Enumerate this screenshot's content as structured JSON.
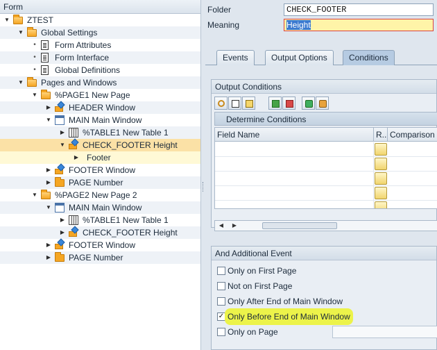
{
  "tree": {
    "header": "Form",
    "nodes": [
      {
        "label": "ZTEST",
        "depth": 0,
        "icon": "folder-open",
        "toggle": "expanded"
      },
      {
        "label": "Global Settings",
        "depth": 1,
        "icon": "folder-open",
        "toggle": "expanded"
      },
      {
        "label": "Form Attributes",
        "depth": 2,
        "icon": "document",
        "toggle": "leaf"
      },
      {
        "label": "Form Interface",
        "depth": 2,
        "icon": "document",
        "toggle": "leaf"
      },
      {
        "label": "Global Definitions",
        "depth": 2,
        "icon": "document",
        "toggle": "leaf"
      },
      {
        "label": "Pages and Windows",
        "depth": 1,
        "icon": "folder-open",
        "toggle": "expanded"
      },
      {
        "label": "%PAGE1 New Page",
        "depth": 2,
        "icon": "folder-open",
        "toggle": "expanded"
      },
      {
        "label": "HEADER Window",
        "depth": 3,
        "icon": "window-node",
        "toggle": "collapsed"
      },
      {
        "label": "MAIN Main Window",
        "depth": 3,
        "icon": "main-window",
        "toggle": "expanded"
      },
      {
        "label": "%TABLE1 New Table 1",
        "depth": 4,
        "icon": "table",
        "toggle": "collapsed"
      },
      {
        "label": "CHECK_FOOTER Height",
        "depth": 4,
        "icon": "condition",
        "toggle": "expanded",
        "selected": true
      },
      {
        "label": "Footer",
        "depth": 5,
        "icon": "none",
        "toggle": "collapsed",
        "sub": true
      },
      {
        "label": "FOOTER Window",
        "depth": 3,
        "icon": "window-node",
        "toggle": "collapsed"
      },
      {
        "label": "PAGE Number",
        "depth": 3,
        "icon": "folder",
        "toggle": "collapsed"
      },
      {
        "label": "%PAGE2 New Page 2",
        "depth": 2,
        "icon": "folder-open",
        "toggle": "expanded"
      },
      {
        "label": "MAIN Main Window",
        "depth": 3,
        "icon": "main-window",
        "toggle": "expanded"
      },
      {
        "label": "%TABLE1 New Table 1",
        "depth": 4,
        "icon": "table",
        "toggle": "collapsed"
      },
      {
        "label": "CHECK_FOOTER Height",
        "depth": 4,
        "icon": "condition",
        "toggle": "collapsed"
      },
      {
        "label": "FOOTER Window",
        "depth": 3,
        "icon": "window-node",
        "toggle": "collapsed"
      },
      {
        "label": "PAGE Number",
        "depth": 3,
        "icon": "folder",
        "toggle": "collapsed"
      }
    ]
  },
  "header": {
    "folder_label": "Folder",
    "folder_value": "CHECK_FOOTER",
    "meaning_label": "Meaning",
    "meaning_value": "Height"
  },
  "tabs": [
    {
      "label": "Events",
      "active": false
    },
    {
      "label": "Output Options",
      "active": false
    },
    {
      "label": "Conditions",
      "active": true
    }
  ],
  "output_conditions": {
    "title": "Output Conditions",
    "toolbar": [
      "cut-icon",
      "copy-icon",
      "paste-icon",
      "insert-row-icon",
      "delete-row-icon",
      "expand-icon",
      "collapse-icon"
    ],
    "subtitle": "Determine Conditions",
    "columns": [
      "Field Name",
      "R..",
      "Comparison V"
    ],
    "row_count": 5
  },
  "additional_event": {
    "title": "And Additional Event",
    "options": [
      {
        "label": "Only on First Page",
        "checked": false
      },
      {
        "label": "Not on First Page",
        "checked": false
      },
      {
        "label": "Only After End of Main Window",
        "checked": false
      },
      {
        "label": "Only Before End of Main Window",
        "checked": true,
        "highlighted": true
      },
      {
        "label": "Only on Page",
        "checked": false,
        "has_input": true
      }
    ]
  },
  "colors": {
    "selection": "#fbe1a6",
    "highlight_marker": "#ecf34a",
    "active_tab": "#b6cbe2"
  }
}
